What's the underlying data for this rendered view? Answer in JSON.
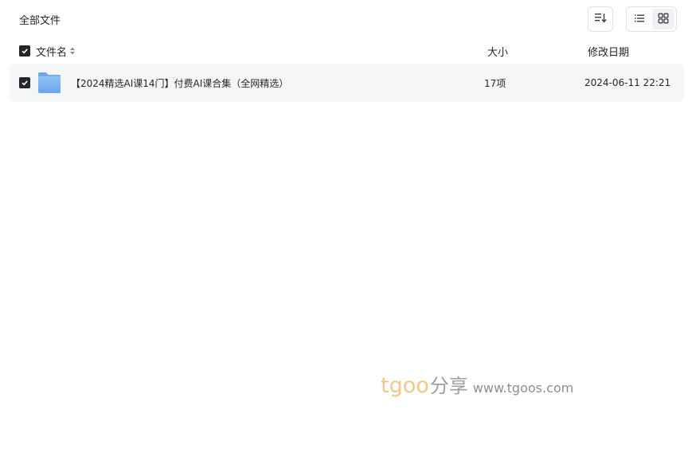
{
  "breadcrumb": {
    "title": "全部文件"
  },
  "toolbar": {
    "sort_icon": "sort-lines-icon",
    "list_view_icon": "list-icon",
    "grid_view_icon": "grid-icon"
  },
  "table": {
    "columns": {
      "name": "文件名",
      "size": "大小",
      "date": "修改日期"
    },
    "rows": [
      {
        "name": "【2024精选AI课14门】付费AI课合集（全网精选）",
        "size": "17项",
        "date": "2024-06-11 22:21",
        "icon": "folder-icon",
        "checked": true
      }
    ]
  },
  "watermark": {
    "brand": "tgoo",
    "cn": "分享",
    "url": "www.tgoos.com"
  },
  "colors": {
    "folder": "#7fb5f2",
    "checkbox": "#25262b",
    "row_bg": "#f5f6f7"
  }
}
